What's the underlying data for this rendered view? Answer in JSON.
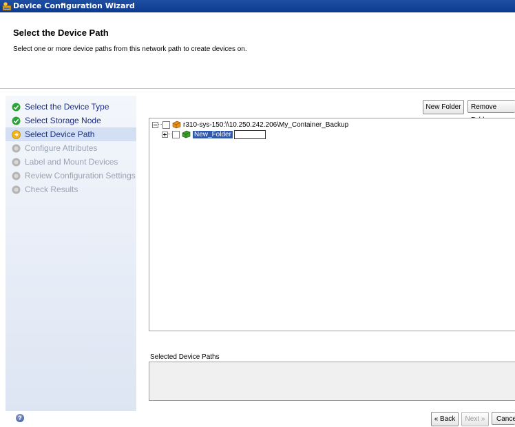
{
  "window": {
    "title": "Device Configuration Wizard"
  },
  "header": {
    "title": "Select the Device Path",
    "subtitle": "Select one or more device paths from this network path to create devices on."
  },
  "steps": [
    {
      "label": "Select the Device Type",
      "state": "done"
    },
    {
      "label": "Select Storage Node",
      "state": "done"
    },
    {
      "label": "Select Device Path",
      "state": "current"
    },
    {
      "label": "Configure Attributes",
      "state": "pending"
    },
    {
      "label": "Label and Mount Devices",
      "state": "pending"
    },
    {
      "label": "Review Configuration Settings",
      "state": "pending"
    },
    {
      "label": "Check Results",
      "state": "pending"
    }
  ],
  "toolbar": {
    "new_folder": "New Folder",
    "remove_folder": "Remove Folder"
  },
  "tree": {
    "root": {
      "label": "r310-sys-150:\\\\10.250.242.206\\My_Container_Backup",
      "expanded": true,
      "checked": false,
      "icon": "storage-icon"
    },
    "child": {
      "label": "New_Folder",
      "expanded": false,
      "checked": false,
      "selected": true,
      "editing": true,
      "icon": "folder-icon"
    }
  },
  "selected_paths": {
    "label": "Selected Device Paths",
    "items": []
  },
  "footer": {
    "back": "« Back",
    "next": "Next »",
    "cancel": "Cancel",
    "help": "?"
  },
  "colors": {
    "titlebar": "#0b3a8e",
    "step_active": "#1c2f88",
    "step_disabled": "#9aa3b3",
    "selection": "#3159a8"
  }
}
